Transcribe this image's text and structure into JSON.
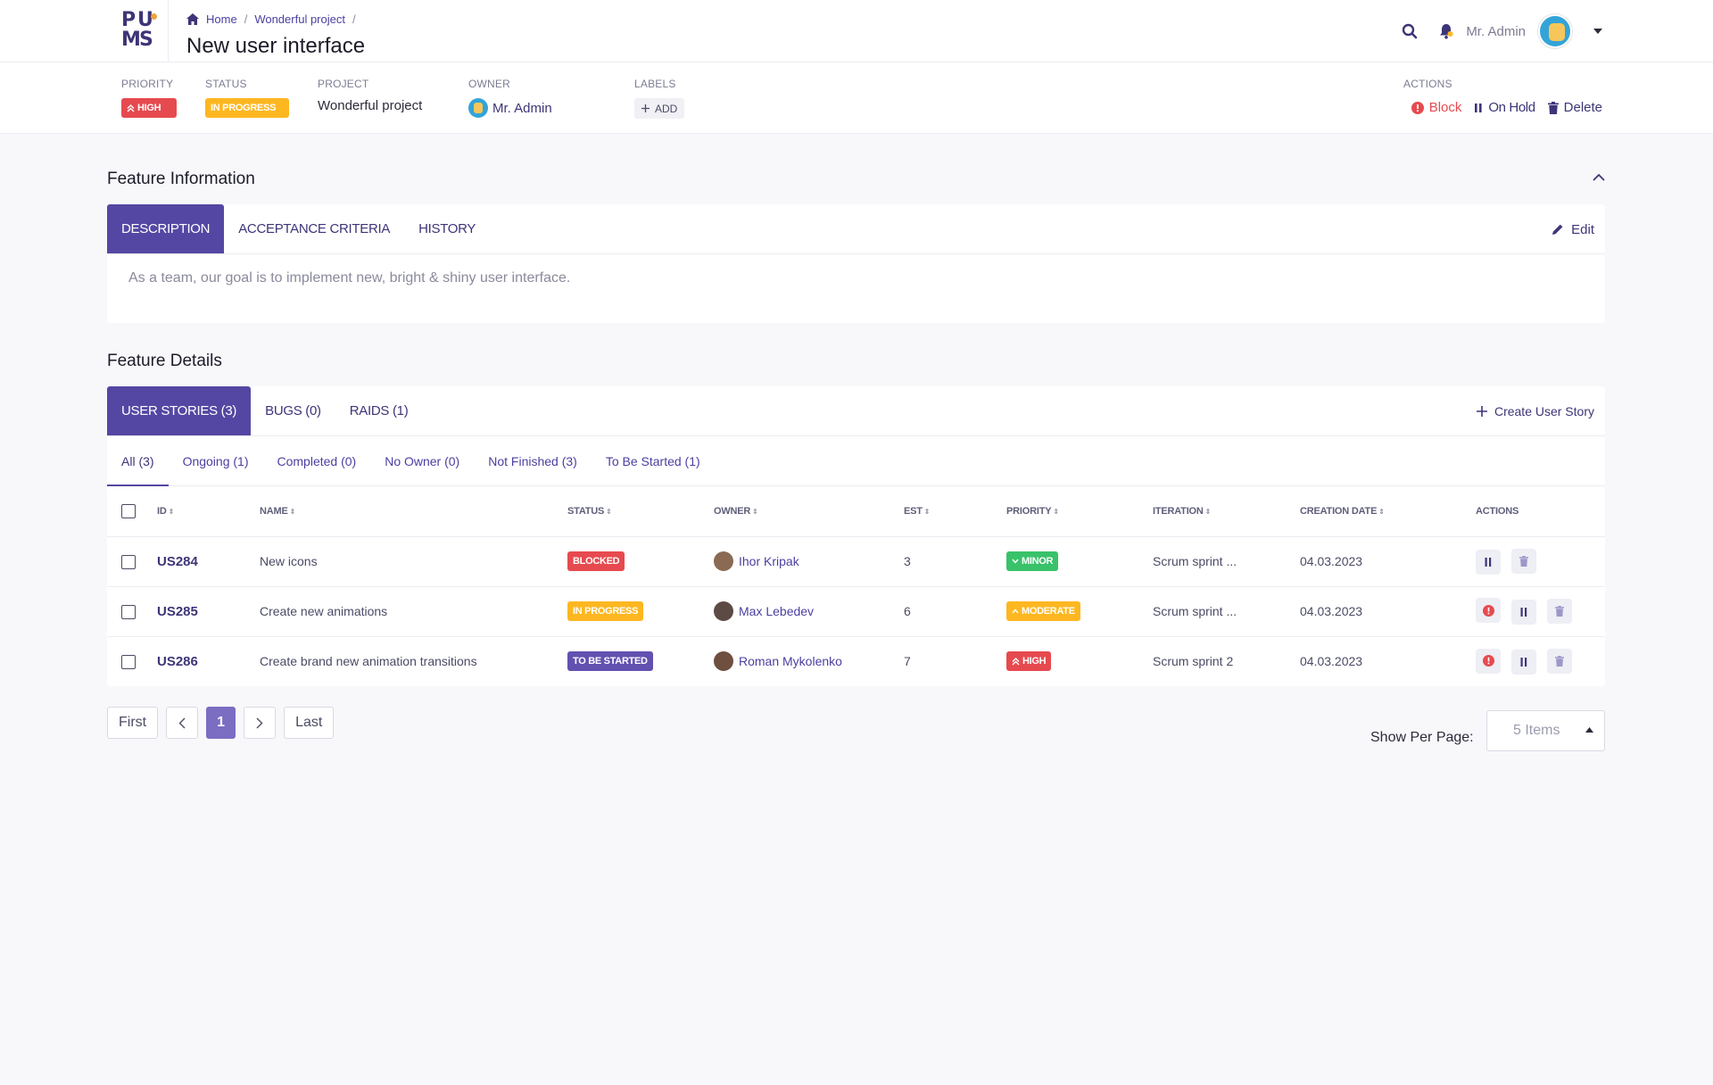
{
  "header": {
    "logo": "PUMS",
    "breadcrumbs": [
      "Home",
      "Wonderful project",
      "/"
    ],
    "title": "New user interface",
    "user_name": "Mr. Admin"
  },
  "meta": {
    "priority_label": "PRIORITY",
    "priority_value": "HIGH",
    "status_label": "STATUS",
    "status_value": "IN PROGRESS",
    "project_label": "PROJECT",
    "project_value": "Wonderful project",
    "owner_label": "OWNER",
    "owner_value": "Mr. Admin",
    "labels_label": "LABELS",
    "labels_add": "ADD",
    "actions_label": "ACTIONS",
    "action_block": "Block",
    "action_onhold": "On Hold",
    "action_delete": "Delete"
  },
  "feature_info": {
    "title": "Feature Information",
    "tabs": [
      "DESCRIPTION",
      "ACCEPTANCE CRITERIA",
      "HISTORY"
    ],
    "edit_label": "Edit",
    "description": "As a team, our goal is to implement new, bright & shiny user interface."
  },
  "feature_details": {
    "title": "Feature Details",
    "tabs": [
      "USER STORIES (3)",
      "BUGS (0)",
      "RAIDS (1)"
    ],
    "create_label": "Create User Story",
    "filters": [
      "All (3)",
      "Ongoing (1)",
      "Completed (0)",
      "No Owner (0)",
      "Not Finished (3)",
      "To Be Started (1)"
    ],
    "columns": [
      "ID",
      "NAME",
      "STATUS",
      "OWNER",
      "EST",
      "PRIORITY",
      "ITERATION",
      "CREATION DATE",
      "ACTIONS"
    ],
    "rows": [
      {
        "id": "US284",
        "name": "New icons",
        "status": "BLOCKED",
        "owner": "Ihor Kripak",
        "est": "3",
        "priority": "MINOR",
        "iteration": "Scrum sprint ...",
        "date": "04.03.2023"
      },
      {
        "id": "US285",
        "name": "Create new animations",
        "status": "IN PROGRESS",
        "owner": "Max Lebedev",
        "est": "6",
        "priority": "MODERATE",
        "iteration": "Scrum sprint ...",
        "date": "04.03.2023"
      },
      {
        "id": "US286",
        "name": "Create brand new animation transitions",
        "status": "TO BE STARTED",
        "owner": "Roman Mykolenko",
        "est": "7",
        "priority": "HIGH",
        "iteration": "Scrum sprint 2",
        "date": "04.03.2023"
      }
    ]
  },
  "pagination": {
    "first": "First",
    "current": "1",
    "last": "Last",
    "per_page_label": "Show Per Page:",
    "per_page_value": "5 Items"
  },
  "colors": {
    "accent": "#5447a3",
    "red": "#e64a4f",
    "yellow": "#fdb721",
    "green": "#39c26a"
  }
}
